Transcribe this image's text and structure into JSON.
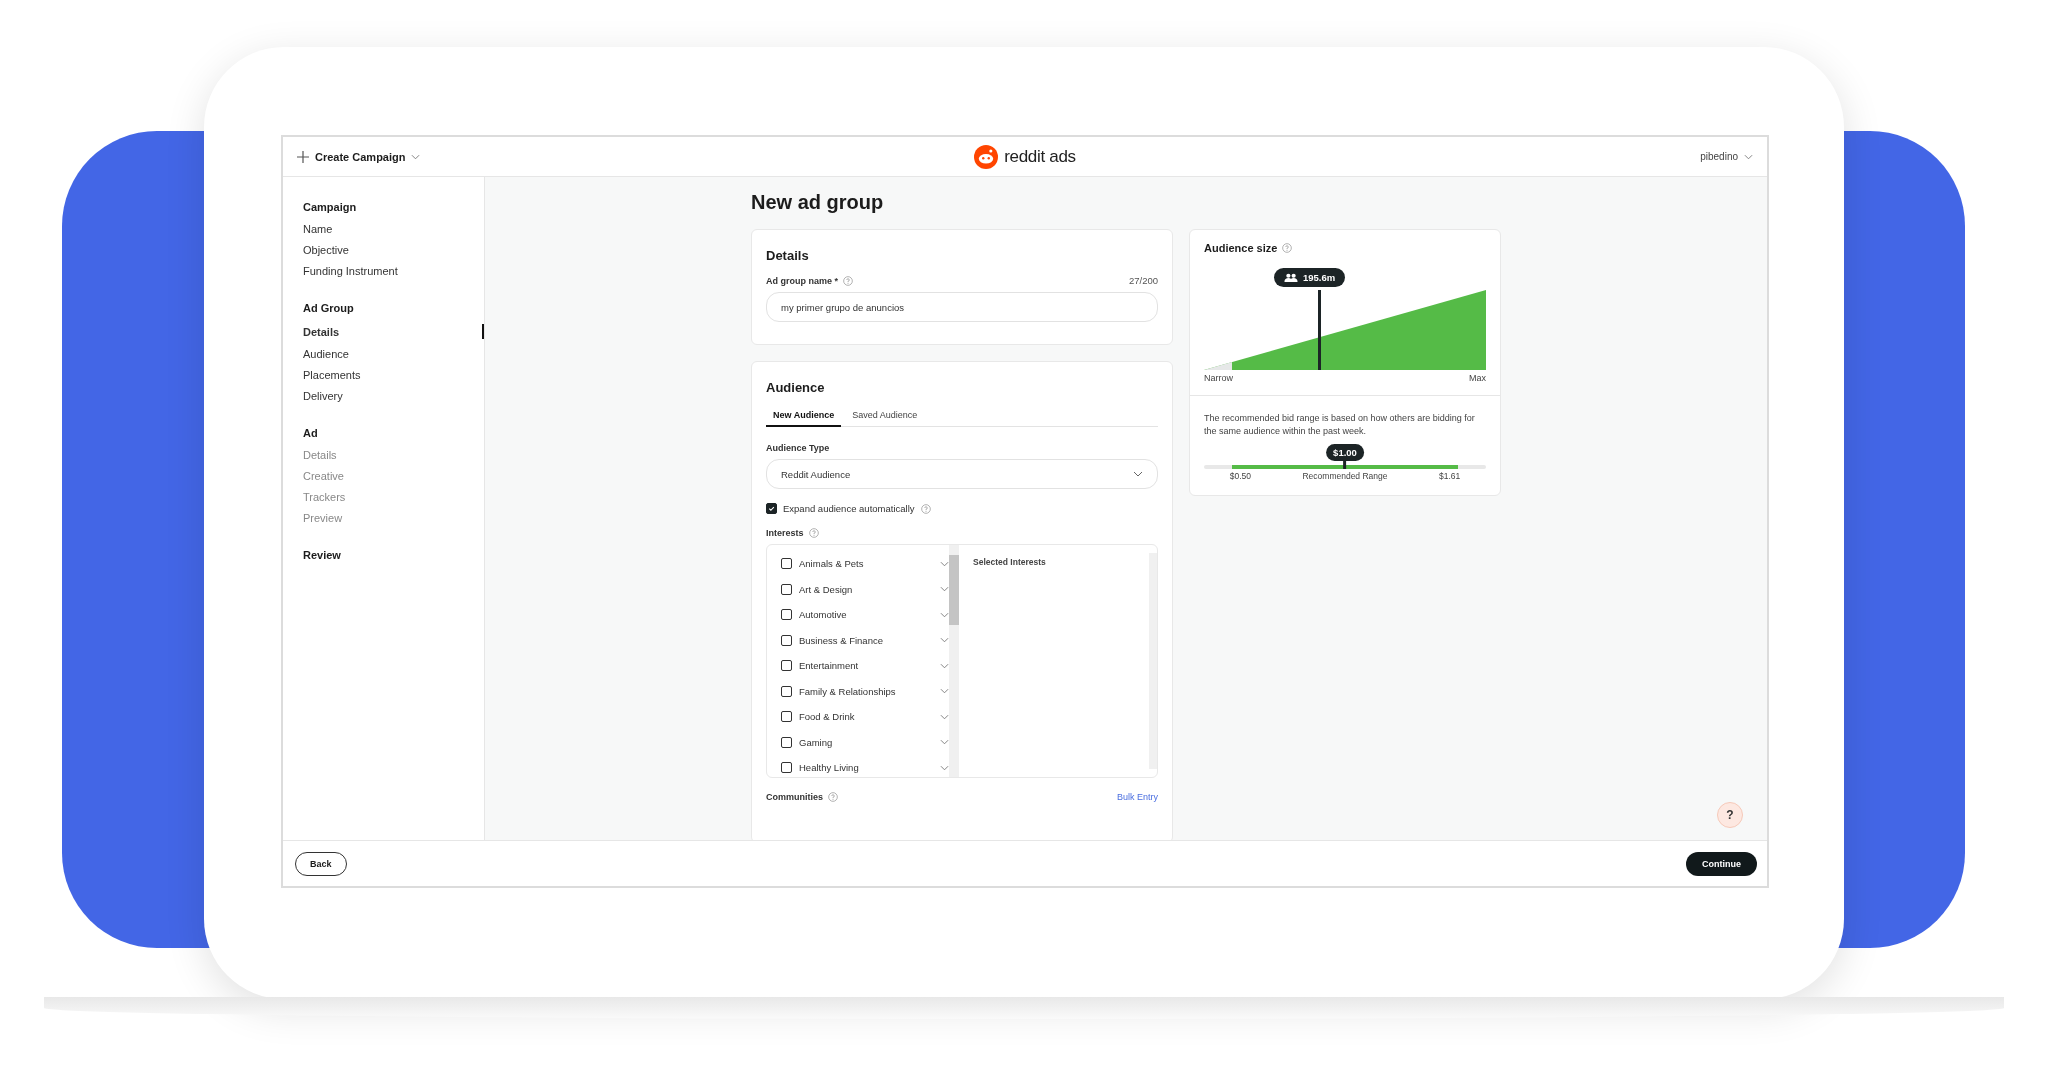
{
  "header": {
    "create_button": "Create Campaign",
    "brand": "reddit ads",
    "account": "pibedino"
  },
  "sidebar": {
    "sections": [
      {
        "title": "Campaign",
        "items": [
          {
            "label": "Name",
            "selected": false,
            "disabled": false
          },
          {
            "label": "Objective",
            "selected": false,
            "disabled": false
          },
          {
            "label": "Funding Instrument",
            "selected": false,
            "disabled": false
          }
        ]
      },
      {
        "title": "Ad Group",
        "items": [
          {
            "label": "Details",
            "selected": true,
            "disabled": false
          },
          {
            "label": "Audience",
            "selected": false,
            "disabled": false
          },
          {
            "label": "Placements",
            "selected": false,
            "disabled": false
          },
          {
            "label": "Delivery",
            "selected": false,
            "disabled": false
          }
        ]
      },
      {
        "title": "Ad",
        "items": [
          {
            "label": "Details",
            "selected": false,
            "disabled": true
          },
          {
            "label": "Creative",
            "selected": false,
            "disabled": true
          },
          {
            "label": "Trackers",
            "selected": false,
            "disabled": true
          },
          {
            "label": "Preview",
            "selected": false,
            "disabled": true
          }
        ]
      },
      {
        "title": "Review"
      }
    ]
  },
  "page_title": "New ad group",
  "details": {
    "title": "Details",
    "name_label": "Ad group name *",
    "counter": "27/200",
    "name_value": "my primer grupo de anuncios"
  },
  "audience": {
    "title": "Audience",
    "tabs": [
      {
        "label": "New Audience",
        "selected": true
      },
      {
        "label": "Saved Audience",
        "selected": false
      }
    ],
    "type_label": "Audience Type",
    "type_value": "Reddit Audience",
    "expand": {
      "label": "Expand audience automatically",
      "checked": true
    },
    "interests_label": "Interests",
    "interests": [
      {
        "label": "Animals & Pets",
        "checked": false
      },
      {
        "label": "Art & Design",
        "checked": false
      },
      {
        "label": "Automotive",
        "checked": false
      },
      {
        "label": "Business & Finance",
        "checked": false
      },
      {
        "label": "Entertainment",
        "checked": false
      },
      {
        "label": "Family & Relationships",
        "checked": false
      },
      {
        "label": "Food & Drink",
        "checked": false
      },
      {
        "label": "Gaming",
        "checked": false
      },
      {
        "label": "Healthy Living",
        "checked": false
      }
    ],
    "selected_title": "Selected Interests",
    "communities_label": "Communities",
    "bulk_entry": "Bulk Entry"
  },
  "audience_size": {
    "title": "Audience size",
    "reading": "195.6m",
    "low_label": "Narrow",
    "high_label": "Max"
  },
  "bid": {
    "text": "The recommended bid range is based on how others are bidding for the same audience within the past week.",
    "reading": "$1.00",
    "level": 0.5,
    "min": "$0.50",
    "range_label": "Recommended Range",
    "max": "$1.61"
  },
  "help_button": "?",
  "footer": {
    "back": "Back",
    "continue": "Continue"
  }
}
